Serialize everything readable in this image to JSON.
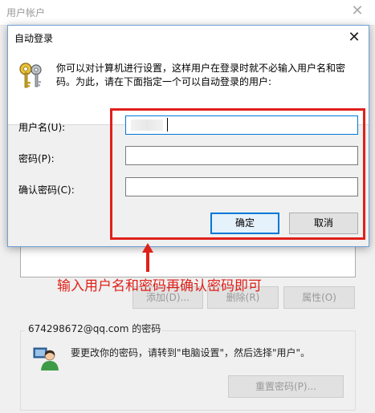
{
  "background_window": {
    "title": "用户帐户",
    "close_glyph": "✕",
    "buttons": {
      "add": "添加(D)...",
      "remove": "删除(R)",
      "properties": "属性(O)"
    },
    "password_group": {
      "label": "674298672@qq.com 的密码",
      "info": "要更改你的密码，请转到\"电脑设置\"，然后选择\"用户\"。",
      "reset_button": "重置密码(P)..."
    }
  },
  "dialog": {
    "title": "自动登录",
    "close_glyph": "✕",
    "description": "你可以对计算机进行设置，这样用户在登录时就不必输入用户名和密码。为此，请在下面指定一个可以自动登录的用户:",
    "fields": {
      "username_label": "用户名(U):",
      "password_label": "密码(P):",
      "confirm_label": "确认密码(C):"
    },
    "ok_label": "确定",
    "cancel_label": "取消"
  },
  "annotation": {
    "text": "输入用户名和密码再确认密码即可",
    "color": "#e0201a"
  },
  "icons": [
    "keys-icon",
    "users-icon",
    "close-icon",
    "arrow-up-icon"
  ]
}
